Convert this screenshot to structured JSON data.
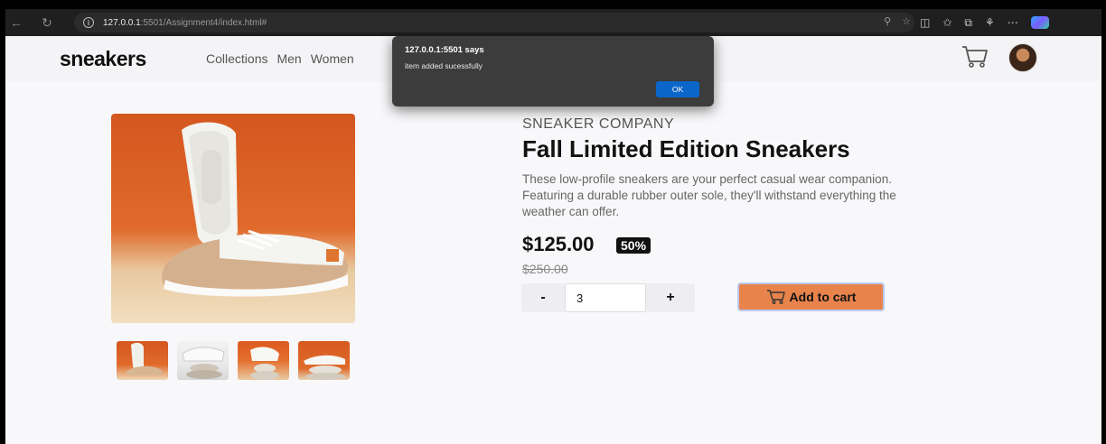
{
  "browser": {
    "url_host": "127.0.0.1",
    "url_rest": ":5501/Assignment4/index.html#"
  },
  "header": {
    "logo": "sneakers",
    "nav": [
      "Collections",
      "Men",
      "Women"
    ]
  },
  "product": {
    "company": "SNEAKER COMPANY",
    "title": "Fall Limited Edition Sneakers",
    "description": "These low-profile sneakers are your perfect casual wear companion. Featuring a durable rubber outer sole, they'll withstand everything the weather can offer.",
    "price": "$125.00",
    "discount": "50%",
    "old_price": "$250.00",
    "quantity": "3",
    "minus_label": "-",
    "plus_label": "+",
    "add_to_cart_label": "Add to cart"
  },
  "dialog": {
    "title": "127.0.0.1:5501 says",
    "message": "item added sucessfully",
    "ok_label": "OK"
  },
  "colors": {
    "accent": "#e9834c",
    "dialog_bg": "#3c3c3c",
    "ok_button": "#0b66c9"
  },
  "icons": [
    "back-icon",
    "refresh-icon",
    "info-icon",
    "zoom-icon",
    "favorite-icon",
    "split-screen-icon",
    "favorites-list-icon",
    "collections-icon",
    "extensions-icon",
    "more-icon",
    "copilot-icon",
    "cart-icon",
    "avatar"
  ]
}
